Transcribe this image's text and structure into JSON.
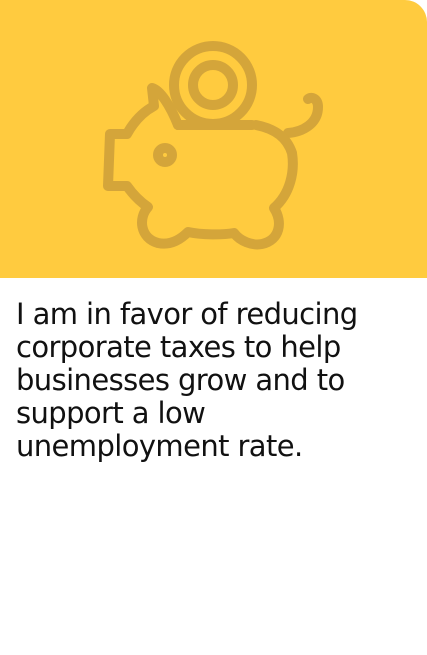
{
  "colors": {
    "accent": "#FFCB3F",
    "icon_stroke": "#D4A53A",
    "text": "#111111",
    "background": "#FFFFFF"
  },
  "card": {
    "icon": "piggy-bank-icon",
    "statement": "I am in favor of reducing corporate taxes to help businesses grow and to support a low unemployment rate."
  }
}
